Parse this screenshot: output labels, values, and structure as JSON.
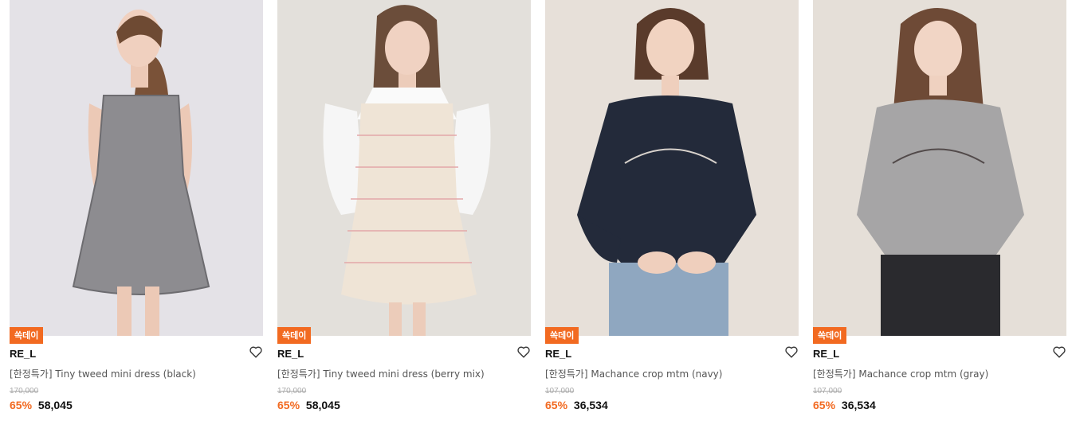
{
  "products": [
    {
      "badge": "쏙데이",
      "brand": "RE_L",
      "title": "[한정특가] Tiny tweed mini dress (black)",
      "original_price": "170,000",
      "discount": "65%",
      "price": "58,045",
      "image_icon": "product-photo-black-tweed-dress"
    },
    {
      "badge": "쏙데이",
      "brand": "RE_L",
      "title": "[한정특가] Tiny tweed mini dress (berry mix)",
      "original_price": "170,000",
      "discount": "65%",
      "price": "58,045",
      "image_icon": "product-photo-berry-tweed-dress"
    },
    {
      "badge": "쏙데이",
      "brand": "RE_L",
      "title": "[한정특가] Machance crop mtm (navy)",
      "original_price": "107,000",
      "discount": "65%",
      "price": "36,534",
      "image_icon": "product-photo-navy-sweatshirt"
    },
    {
      "badge": "쏙데이",
      "brand": "RE_L",
      "title": "[한정특가] Machance crop mtm (gray)",
      "original_price": "107,000",
      "discount": "65%",
      "price": "36,534",
      "image_icon": "product-photo-gray-sweatshirt"
    }
  ],
  "colors": {
    "accent": "#f26a21",
    "sale_badge": "#f26a21"
  }
}
